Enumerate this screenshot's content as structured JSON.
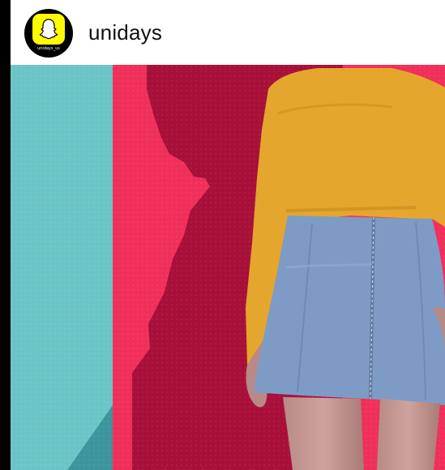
{
  "post": {
    "username": "unidays",
    "avatar": {
      "icon": "snapchat-ghost-icon",
      "caption": "unidays_us",
      "badge_color": "#fffc00"
    },
    "image": {
      "subject": "photo-icon",
      "colors": {
        "turquoise_wall": "#6cc5c6",
        "pink_wall": "#f0305a",
        "crimson_wall": "#a8103a",
        "sweater": "#e4a62c",
        "skirt": "#7e9bc6"
      }
    }
  }
}
